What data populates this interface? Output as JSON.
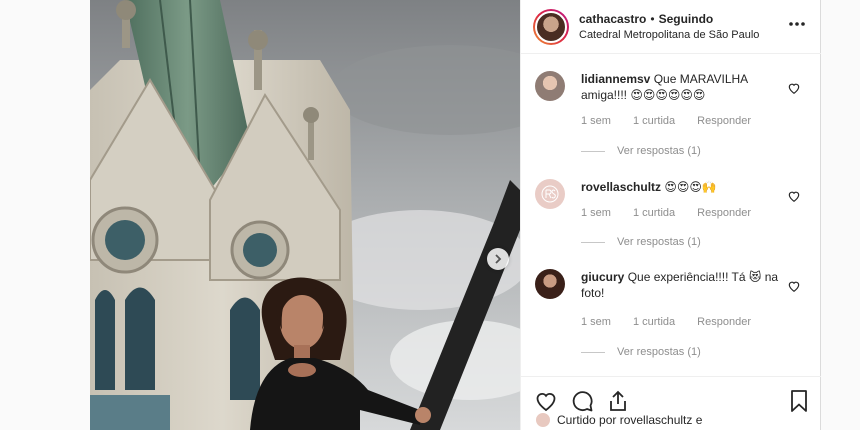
{
  "header": {
    "username": "cathacastro",
    "separator": "•",
    "follow_status": "Seguindo",
    "location": "Catedral Metropolitana de São Paulo"
  },
  "comments": [
    {
      "username": "lidiannemsv",
      "text": "Que MARAVILHA amiga!!!! 😍😍😍😍😍😍",
      "time": "1 sem",
      "likes": "1 curtida",
      "reply": "Responder",
      "view_replies": "Ver respostas (1)"
    },
    {
      "username": "rovellaschultz",
      "text": "😍😍😍🙌",
      "time": "1 sem",
      "likes": "1 curtida",
      "reply": "Responder",
      "view_replies": "Ver respostas (1)"
    },
    {
      "username": "giucury",
      "text": "Que experiência!!!! Tá 😻 na foto!",
      "time": "1 sem",
      "likes": "1 curtida",
      "reply": "Responder",
      "view_replies": "Ver respostas (1)"
    }
  ],
  "footer": {
    "liked_by": "Curtido por rovellaschultz e"
  },
  "icons": {
    "like": "heart-icon",
    "comment": "comment-icon",
    "share": "share-icon",
    "save": "bookmark-icon",
    "more": "more-options-icon",
    "next": "chevron-right-icon"
  }
}
